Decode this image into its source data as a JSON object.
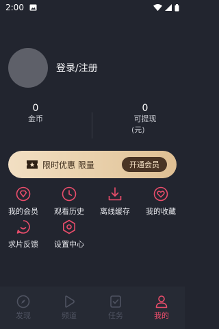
{
  "status_bar": {
    "time": "2:00",
    "icons": [
      "image-icon",
      "wifi-icon",
      "signal-icon",
      "battery-icon"
    ]
  },
  "profile": {
    "login_label": "登录/注册"
  },
  "stats": {
    "coins": {
      "value": "0",
      "label": "金币"
    },
    "withdrawable": {
      "value": "0",
      "label_line1": "可提现",
      "label_line2": "(元)"
    }
  },
  "promo": {
    "text": "限时优惠 限量",
    "button": "开通会员"
  },
  "features": [
    {
      "label": "我的会员",
      "icon": "vip-diamond-icon"
    },
    {
      "label": "观看历史",
      "icon": "clock-icon"
    },
    {
      "label": "离线缓存",
      "icon": "download-icon"
    },
    {
      "label": "我的收藏",
      "icon": "heart-icon"
    },
    {
      "label": "求片反馈",
      "icon": "feedback-icon"
    },
    {
      "label": "设置中心",
      "icon": "settings-icon"
    }
  ],
  "tabs": [
    {
      "label": "发现",
      "icon": "compass-icon",
      "active": false
    },
    {
      "label": "频道",
      "icon": "play-icon",
      "active": false
    },
    {
      "label": "任务",
      "icon": "task-icon",
      "active": false
    },
    {
      "label": "我的",
      "icon": "user-icon",
      "active": true
    }
  ],
  "colors": {
    "background": "#22252f",
    "accent": "#ea4d6b",
    "promo_gold": "#e9d1ac",
    "inactive_tab": "#4f5361"
  }
}
